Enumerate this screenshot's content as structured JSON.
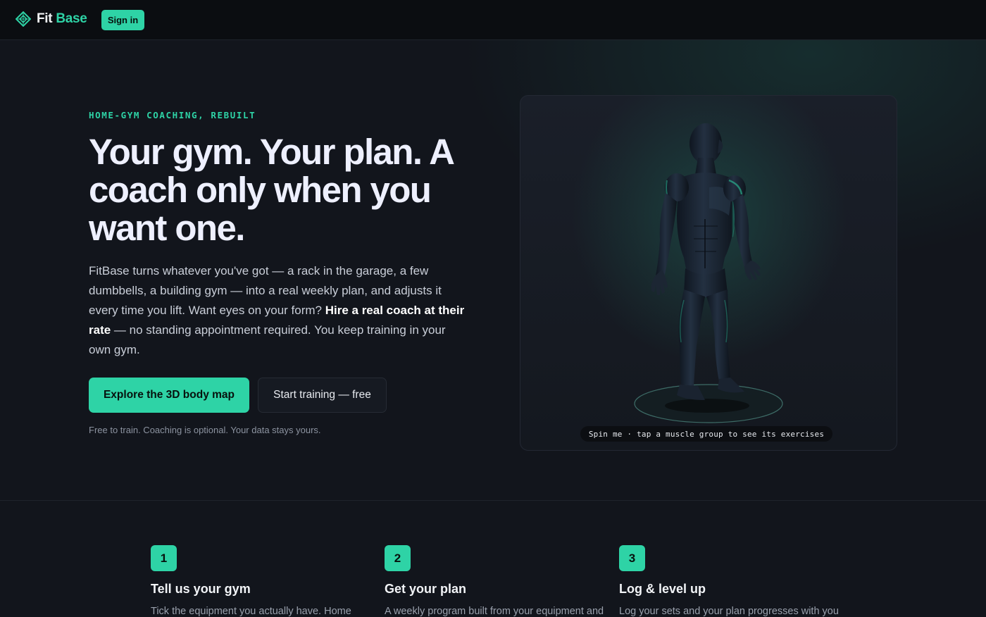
{
  "brand": {
    "name_part1": "Fit",
    "name_part2": "Base",
    "accent": "#2ed3a6"
  },
  "nav": {
    "signin_label": "Sign in"
  },
  "hero": {
    "eyebrow": "HOME-GYM COACHING, REBUILT",
    "headline": "Your gym. Your plan. A coach only when you want one.",
    "lede_part1": "FitBase turns whatever you've got — a rack in the garage, a few dumbbells, a building gym — into a real weekly plan, and adjusts it every time you lift. Want eyes on your form? ",
    "lede_bold": "Hire a real coach at their rate",
    "lede_part2": " — no standing appointment required. You keep training in your own gym.",
    "cta_primary": "Explore the 3D body map",
    "cta_secondary": "Start training — free",
    "fineprint": "Free to train. Coaching is optional. Your data stays yours."
  },
  "viewer": {
    "caption": "Spin me · tap a muscle group to see its exercises",
    "icon": "3d-body-figure"
  },
  "steps": [
    {
      "number": "1",
      "title": "Tell us your gym",
      "desc": "Tick the equipment you actually have. Home"
    },
    {
      "number": "2",
      "title": "Get your plan",
      "desc": "A weekly program built from your equipment and"
    },
    {
      "number": "3",
      "title": "Log & level up",
      "desc": "Log your sets and your plan progresses with you"
    }
  ]
}
